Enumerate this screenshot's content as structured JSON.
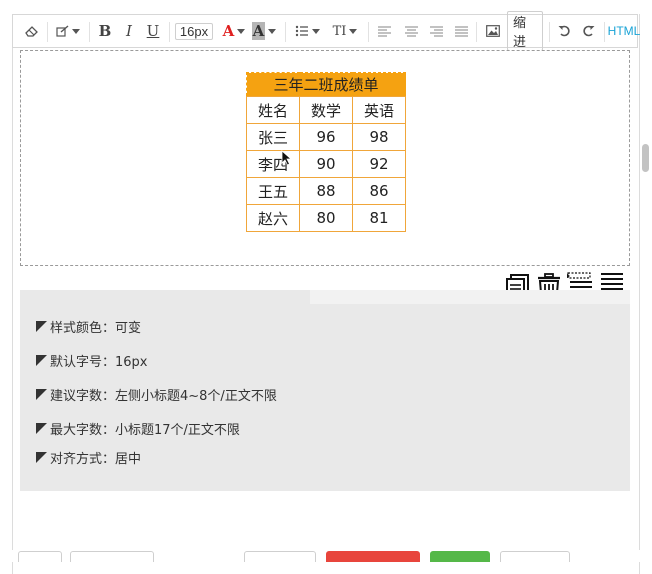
{
  "toolbar": {
    "font_size": "16px",
    "font_color_glyph": "A",
    "bg_color_glyph": "A",
    "bold_glyph": "B",
    "italic_glyph": "I",
    "underline_glyph": "U",
    "text_style_glyph": "TI",
    "indent_label": "缩进",
    "html_label": "HTML",
    "icons": [
      "eraser-icon",
      "brush-icon",
      "list-icon",
      "align-left-icon",
      "align-center-icon",
      "align-right-icon",
      "align-justify-icon",
      "image-icon",
      "undo-icon",
      "redo-icon"
    ],
    "colors": {
      "font_color": "#e02020",
      "html_link": "#1aa3d6"
    }
  },
  "table": {
    "title": "三年二班成绩单",
    "headers": [
      "姓名",
      "数学",
      "英语"
    ],
    "rows": [
      [
        "张三",
        "96",
        "98"
      ],
      [
        "李四",
        "90",
        "92"
      ],
      [
        "王五",
        "88",
        "86"
      ],
      [
        "赵六",
        "80",
        "81"
      ]
    ],
    "accent_color": "#f5a211"
  },
  "actions": {
    "icons": [
      "copy-icon",
      "trash-icon",
      "insert-before-icon",
      "insert-after-icon"
    ]
  },
  "info": {
    "items": [
      "样式颜色：可变",
      "默认字号：16px",
      "建议字数：左侧小标题4~8个/正文不限",
      "最大字数：小标题17个/正文不限",
      "对齐方式：居中"
    ]
  }
}
